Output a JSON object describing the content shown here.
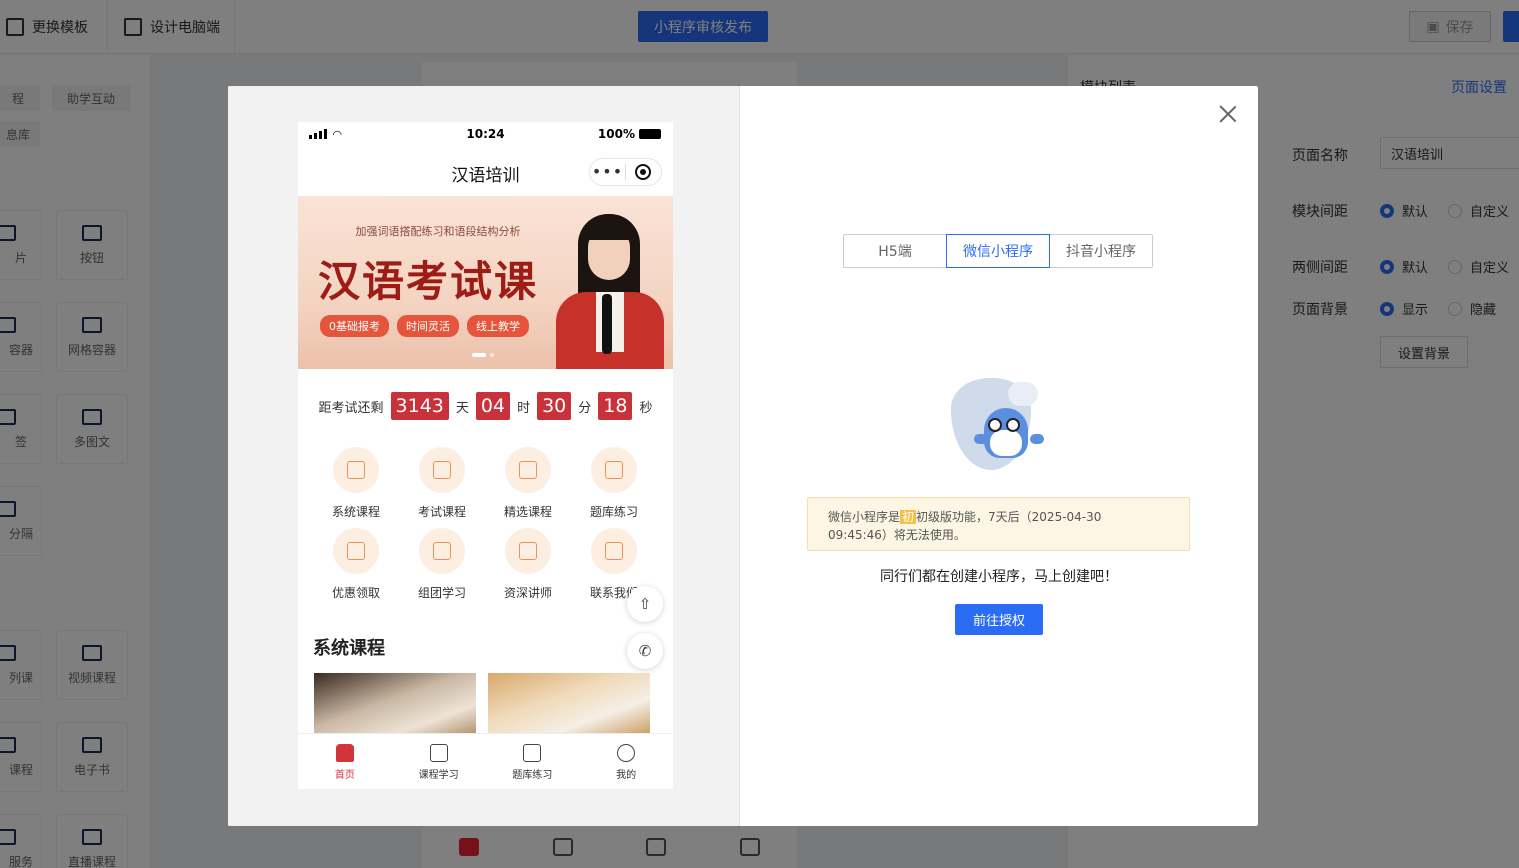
{
  "editor": {
    "top": {
      "change_template": "更换模板",
      "design_pc": "设计电脑端",
      "publish": "小程序审核发布",
      "save": "保存"
    },
    "left": {
      "chips": [
        "程",
        "助学互动",
        "息库"
      ],
      "cards": [
        "片",
        "按钮",
        "容器",
        "网格容器",
        "签",
        "多图文",
        "分隔",
        "列课",
        "视频课程",
        "课程",
        "电子书",
        "服务",
        "直播课程"
      ]
    },
    "right": {
      "list_title": "模块列表",
      "page_settings": "页面设置",
      "page_name_label": "页面名称",
      "page_name_value": "汉语培训",
      "module_spacing_label": "模块间距",
      "side_spacing_label": "两侧间距",
      "page_bg_label": "页面背景",
      "opt_default": "默认",
      "opt_custom": "自定义",
      "opt_show": "显示",
      "opt_hide": "隐藏",
      "set_bg_button": "设置背景"
    }
  },
  "modal": {
    "phone": {
      "status_time": "10:24",
      "status_battery": "100%",
      "nav_title": "汉语培训",
      "banner": {
        "subtitle": "加强词语搭配练习和语段结构分析",
        "title": "汉语考试课",
        "tags": [
          "0基础报考",
          "时间灵活",
          "线上教学"
        ]
      },
      "countdown": {
        "prefix": "距考试还剩",
        "days": "3143",
        "days_unit": "天",
        "hours": "04",
        "hours_unit": "时",
        "minutes": "30",
        "minutes_unit": "分",
        "seconds": "18",
        "seconds_unit": "秒"
      },
      "icons": [
        {
          "label": "系统课程",
          "icon": "book-icon"
        },
        {
          "label": "考试课程",
          "icon": "graduation-cap-icon"
        },
        {
          "label": "精选课程",
          "icon": "open-book-icon"
        },
        {
          "label": "题库练习",
          "icon": "pen-icon"
        },
        {
          "label": "优惠领取",
          "icon": "coupon-icon"
        },
        {
          "label": "组团学习",
          "icon": "bag-icon"
        },
        {
          "label": "资深讲师",
          "icon": "teacher-icon"
        },
        {
          "label": "联系我们",
          "icon": "phone-icon"
        }
      ],
      "section_title": "系统课程",
      "tabs": [
        {
          "label": "首页",
          "icon": "home-icon"
        },
        {
          "label": "课程学习",
          "icon": "grid-icon"
        },
        {
          "label": "题库练习",
          "icon": "document-icon"
        },
        {
          "label": "我的",
          "icon": "user-icon"
        }
      ]
    },
    "platform_tabs": [
      "H5端",
      "微信小程序",
      "抖音小程序"
    ],
    "active_tab": "微信小程序",
    "notice": {
      "prefix": "微信小程序是",
      "highlight": "初",
      "suffix": "初级版功能，7天后（2025-04-30",
      "line2": "09:45:46）将无法使用。"
    },
    "cta_text": "同行们都在创建小程序，马上创建吧！",
    "cta_button": "前往授权"
  },
  "colors": {
    "accent": "#2b6cf5",
    "brand_red": "#c8323a",
    "notice_bg": "#fdf6e4"
  }
}
